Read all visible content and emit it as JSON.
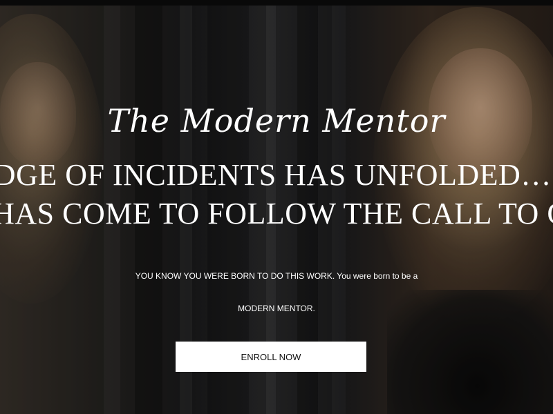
{
  "hero": {
    "script_title": "The Modern Mentor",
    "headline": "A RIDGE OF INCIDENTS HAS UNFOLDED… THE TIME HAS COME TO FOLLOW THE CALL TO GOOD.",
    "subtext_line1": "YOU KNOW YOU WERE BORN TO DO THIS WORK. You were born to be a",
    "subtext_line2": "MODERN MENTOR.",
    "cta_label": "ENROLL NOW"
  },
  "colors": {
    "text": "#ffffff",
    "button_bg": "#ffffff",
    "button_text": "#111111",
    "background": "#141414"
  }
}
